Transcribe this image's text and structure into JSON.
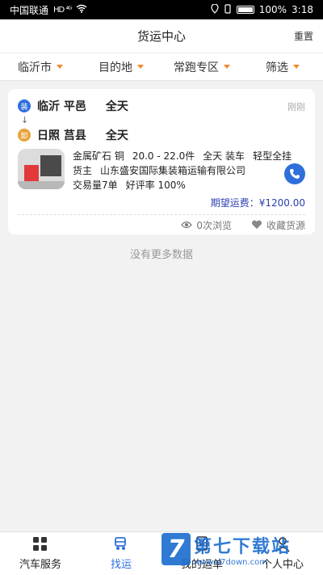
{
  "status_bar": {
    "carrier": "中国联通",
    "carrier_tags": "HD ⁴ᴳ",
    "battery": "100%",
    "time": "3:18"
  },
  "header": {
    "title": "货运中心",
    "reset_label": "重置"
  },
  "filters": [
    {
      "label": "临沂市"
    },
    {
      "label": "目的地"
    },
    {
      "label": "常跑专区"
    },
    {
      "label": "筛选"
    }
  ],
  "listing": {
    "load_badge": "装",
    "unload_badge": "卸",
    "origin": "临沂 平邑",
    "origin_time": "全天",
    "destination": "日照 莒县",
    "destination_time": "全天",
    "posted": "刚刚",
    "arrow": "↓",
    "line1": {
      "cargo": "金属矿石 铜",
      "amount": "20.0 - 22.0件",
      "time": "全天 装车",
      "truck": "轻型全挂"
    },
    "line2": {
      "label": "货主",
      "company": "山东盛安国际集装箱运输有限公司"
    },
    "line3": {
      "trades": "交易量7单",
      "rating": "好评率 100%"
    },
    "price_label": "期望运费：",
    "price_value": "¥1200.00",
    "views": "0次浏览",
    "favorite": "收藏货源"
  },
  "no_more": "没有更多数据",
  "tabs": [
    {
      "label": "汽车服务",
      "icon": "grid-icon"
    },
    {
      "label": "找运",
      "icon": "truck-icon"
    },
    {
      "label": "我的运单",
      "icon": "document-icon"
    },
    {
      "label": "个人中心",
      "icon": "user-icon"
    }
  ],
  "watermark": {
    "logo": "7",
    "name": "第七下载站",
    "url": "www.d7down.com"
  },
  "colors": {
    "accent": "#2f6fdc",
    "filter_arrow": "#f08a24",
    "price": "#2b3fb0"
  }
}
